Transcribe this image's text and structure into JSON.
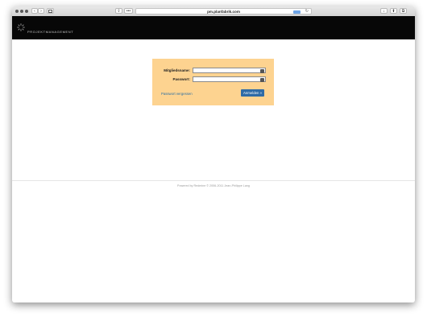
{
  "browser": {
    "nav": {
      "back": "‹",
      "forward": "›"
    },
    "sidebar_icon": "sidebar-icon",
    "share_icon": "share-icon",
    "reader_label": "•••",
    "url": "pm.planfabrik.com",
    "reload_icon": "↻",
    "right_buttons": [
      "↓",
      "⬆",
      "⧉"
    ]
  },
  "header": {
    "logo_icon": "sunburst-logo-icon",
    "title": "PROJEKTMANAGEMENT"
  },
  "login": {
    "username_label": "Mitgliedsname:",
    "username_value": "",
    "password_label": "Passwort:",
    "password_value": "",
    "forgot_link": "Passwort vergessen",
    "submit_label": "Anmelden »",
    "box_color": "#fdd390",
    "button_color": "#2e6ba6"
  },
  "footer": {
    "text": "Powered by Redmine © 2006-2011 Jean-Philippe Lang"
  }
}
